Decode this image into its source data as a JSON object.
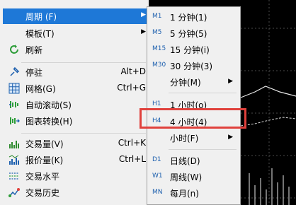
{
  "main_menu": {
    "items": [
      {
        "label": "周期 (F)",
        "icon": "blank",
        "arrow": "▶",
        "highlighted": true
      },
      {
        "label": "模板(T)",
        "icon": "blank",
        "arrow": "▶"
      },
      {
        "label": "刷新",
        "icon": "refresh-icon"
      },
      {
        "label": "停驻",
        "icon": "pin-icon",
        "shortcut": "Alt+D"
      },
      {
        "label": "网格(G)",
        "icon": "grid-icon",
        "shortcut": "Ctrl+G"
      },
      {
        "label": "自动滚动(S)",
        "icon": "autoscroll-icon"
      },
      {
        "label": "图表转换(H)",
        "icon": "chart-shift-icon"
      },
      {
        "label": "交易量(V)",
        "icon": "volume-icon",
        "shortcut": "Ctrl+K"
      },
      {
        "label": "报价量(K)",
        "icon": "tick-volume-icon",
        "shortcut": "Ctrl+L"
      },
      {
        "label": "交易水平",
        "icon": "trade-levels-icon"
      },
      {
        "label": "交易历史",
        "icon": "trade-history-icon"
      }
    ]
  },
  "period_menu": {
    "items": [
      {
        "badge": "M1",
        "label": "1 分钟(1)"
      },
      {
        "badge": "M5",
        "label": "5 分钟(5)"
      },
      {
        "badge": "M15",
        "label": "15 分钟(i)"
      },
      {
        "badge": "M30",
        "label": "30 分钟(3)"
      },
      {
        "badge": "",
        "label": "分钟(M)",
        "arrow": "▶"
      },
      {
        "badge": "H1",
        "label": "1 小时(o)"
      },
      {
        "badge": "H4",
        "label": "4 小时(4)"
      },
      {
        "badge": "",
        "label": "小时(F)",
        "arrow": "▶"
      },
      {
        "badge": "D1",
        "label": "日线(D)"
      },
      {
        "badge": "W1",
        "label": "周线(W)"
      },
      {
        "badge": "MN",
        "label": "每月(n)"
      }
    ]
  },
  "colors": {
    "highlight": "#1e78d7",
    "annotation_box": "#e0413c",
    "badge_text": "#1c5fae"
  }
}
